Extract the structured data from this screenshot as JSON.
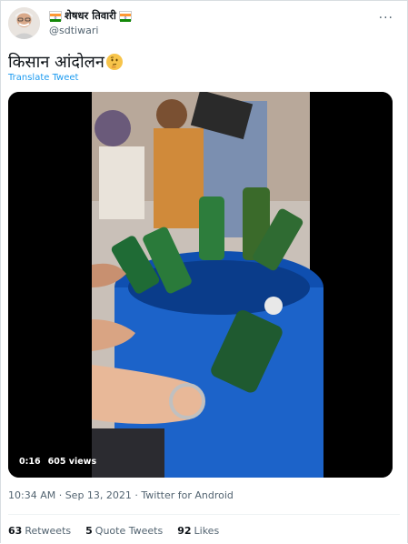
{
  "user": {
    "display_name": "शेषधर तिवारी",
    "handle": "@sdtiwari",
    "flag_colors": [
      "#ff9933",
      "#ffffff",
      "#138808"
    ]
  },
  "tweet": {
    "text": "किसान आंदोलन",
    "emoji": "thinking-face",
    "translate_label": "Translate Tweet"
  },
  "video": {
    "time": "0:16",
    "views": "605 views"
  },
  "meta": {
    "timestamp": "10:34 AM · Sep 13, 2021 · Twitter for Android"
  },
  "stats": {
    "retweets_count": "63",
    "retweets_label": "Retweets",
    "quote_count": "5",
    "quote_label": "Quote Tweets",
    "likes_count": "92",
    "likes_label": "Likes"
  },
  "colors": {
    "link": "#1d9bf0",
    "muted": "#536471",
    "text": "#0f1419"
  }
}
